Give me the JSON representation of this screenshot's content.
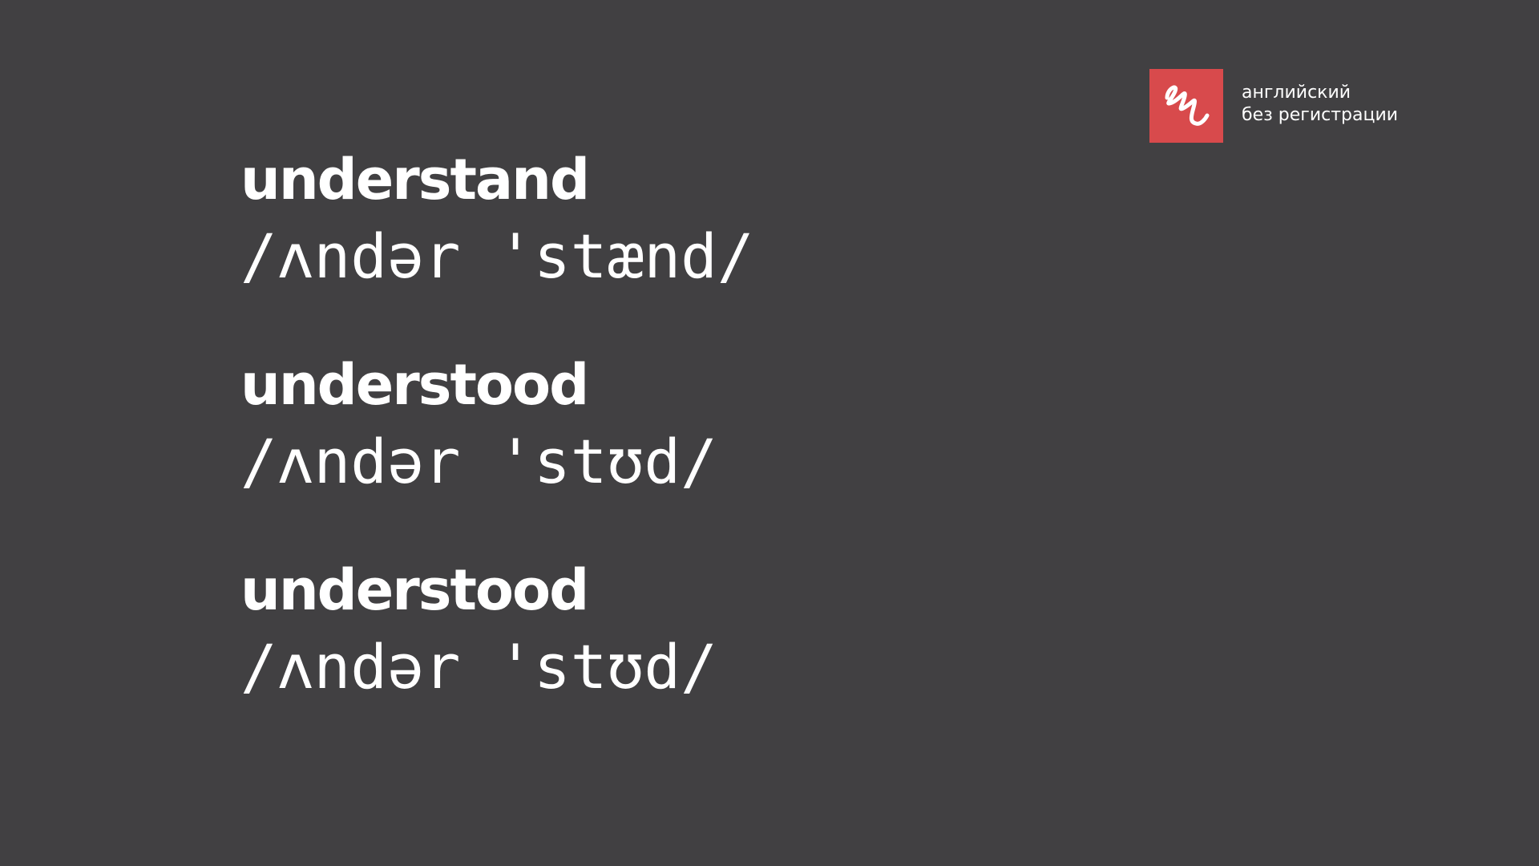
{
  "brand": {
    "line1": "английский",
    "line2": "без регистрации",
    "logo_icon": "squiggle-icon",
    "logo_color": "#d84a4c"
  },
  "background_color": "#414042",
  "entries": [
    {
      "word": "understand",
      "transcription": "/ʌndər 'stænd/"
    },
    {
      "word": "understood",
      "transcription": "/ʌndər 'stʊd/"
    },
    {
      "word": "understood",
      "transcription": "/ʌndər 'stʊd/"
    }
  ]
}
